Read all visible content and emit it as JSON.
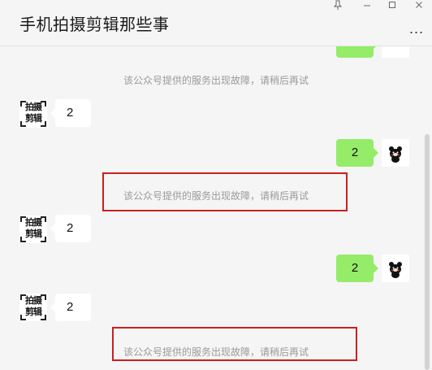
{
  "window": {
    "title": "手机拍摄剪辑那些事",
    "more_label": "...",
    "pin_icon": "pin-icon",
    "minimize_icon": "minimize-icon",
    "maximize_icon": "maximize-icon",
    "close_icon": "close-icon"
  },
  "colors": {
    "background": "#f5f5f5",
    "bubble_self": "#95ec69",
    "bubble_other": "#ffffff",
    "system_text": "#9a9a9a",
    "highlight": "#c9201e"
  },
  "avatar_logo": {
    "line1": "拍摄",
    "line2": "剪辑"
  },
  "messages": {
    "sys1": "该公众号提供的服务出现故障，请稍后再试",
    "in1": "2",
    "out1": "2",
    "sys2": "该公众号提供的服务出现故障，请稍后再试",
    "in2": "2",
    "out2": "2",
    "in3": "2",
    "sys3": "该公众号提供的服务出现故障，请稍后再试"
  }
}
